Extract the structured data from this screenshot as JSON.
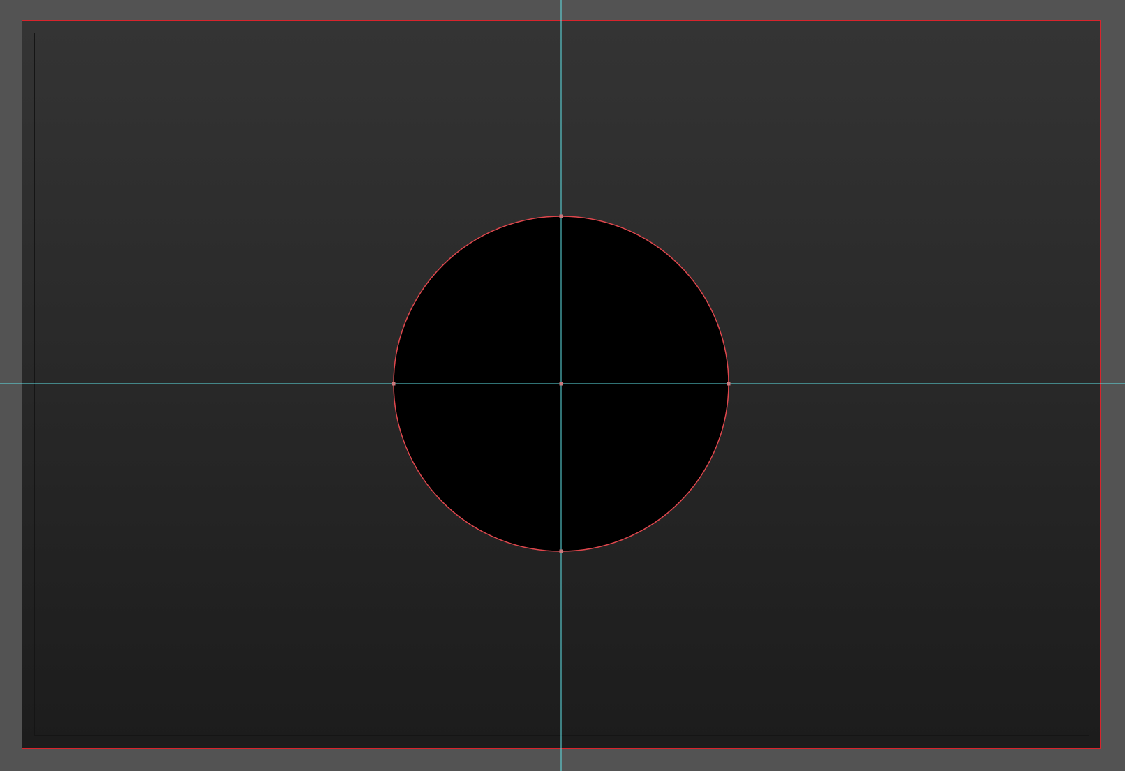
{
  "canvas": {
    "background_color": "#535353",
    "artboard_border_color": "#d8242c",
    "artboard_fill_top": "#343434",
    "artboard_fill_bottom": "#1c1c1c",
    "inner_frame_color": "#151515"
  },
  "shape": {
    "type": "ellipse",
    "fill_color": "#000000",
    "stroke_color": "#e0474d",
    "selected": true,
    "anchor_point_color": "#c97a7e"
  },
  "guides": {
    "color": "#5fe3e8",
    "vertical": true,
    "horizontal": true
  }
}
